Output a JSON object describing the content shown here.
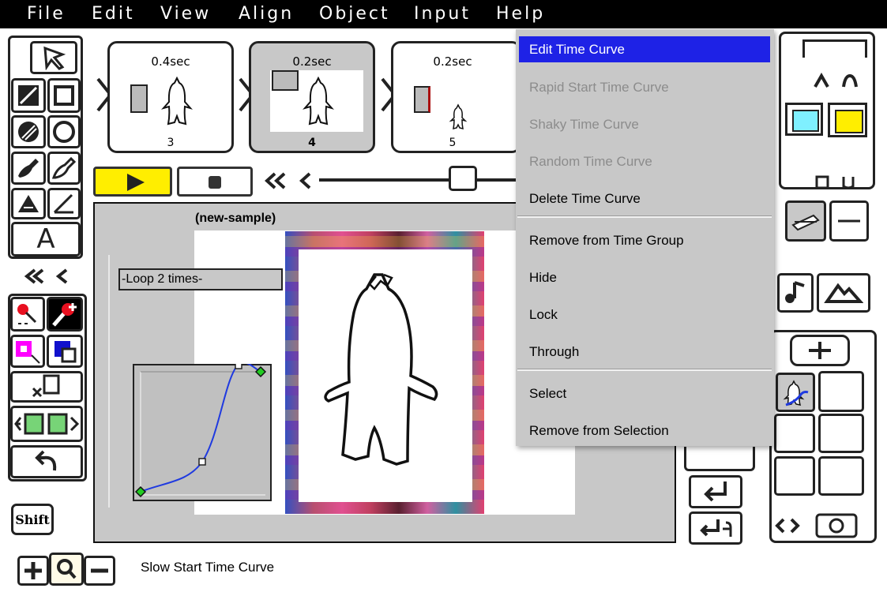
{
  "menubar": {
    "items": [
      "File",
      "Edit",
      "View",
      "Align",
      "Object",
      "Input",
      "Help"
    ]
  },
  "frames": [
    {
      "duration": "0.4sec",
      "number": "3"
    },
    {
      "duration": "0.2sec",
      "number": "4"
    },
    {
      "duration": "0.2sec",
      "number": "5"
    }
  ],
  "canvas": {
    "sample_title": "(new-sample)",
    "loop_label": "-Loop 2 times-"
  },
  "toolbar": {
    "shift_label": "Shift",
    "text_tool_label": "A"
  },
  "context_menu": {
    "items": [
      {
        "label": "Edit Time Curve",
        "state": "selected"
      },
      {
        "label": "Rapid Start Time Curve",
        "state": "disabled"
      },
      {
        "label": "Shaky Time Curve",
        "state": "disabled"
      },
      {
        "label": "Random Time Curve",
        "state": "disabled"
      },
      {
        "label": "Delete Time Curve",
        "state": "enabled"
      },
      {
        "label": "Remove from Time Group",
        "state": "enabled"
      },
      {
        "label": "Hide",
        "state": "enabled"
      },
      {
        "label": "Lock",
        "state": "enabled"
      },
      {
        "label": "Through",
        "state": "enabled"
      },
      {
        "label": "Select",
        "state": "enabled"
      },
      {
        "label": "Remove from Selection",
        "state": "enabled"
      }
    ]
  },
  "status_bar": {
    "text": "Slow Start Time Curve"
  },
  "colors": {
    "menubar_bg": "#000000",
    "menu_selected": "#1e22e6",
    "play_button": "#ffee00",
    "swatch_primary": "#7ff0ff",
    "swatch_secondary": "#ffee00",
    "curve_line": "#1f3ae0",
    "curve_endpoint": "#22cc22"
  }
}
